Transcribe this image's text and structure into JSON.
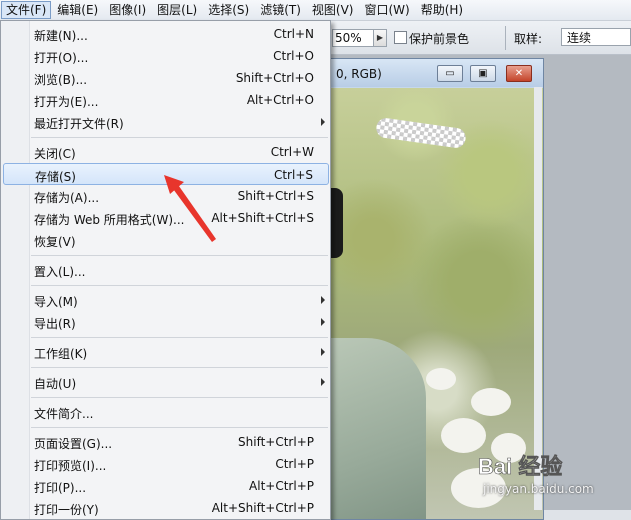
{
  "menubar": {
    "items": [
      {
        "label": "文件(F)"
      },
      {
        "label": "编辑(E)"
      },
      {
        "label": "图像(I)"
      },
      {
        "label": "图层(L)"
      },
      {
        "label": "选择(S)"
      },
      {
        "label": "滤镜(T)"
      },
      {
        "label": "视图(V)"
      },
      {
        "label": "窗口(W)"
      },
      {
        "label": "帮助(H)"
      }
    ]
  },
  "options": {
    "zoom_value": "50%",
    "checkbox_label": "保护前景色",
    "sample_label": "取样:",
    "sample_value": "连续"
  },
  "document": {
    "title_fragment": "0, RGB)",
    "minimize_glyph": "▭",
    "maximize_glyph": "▣",
    "close_glyph": "✕"
  },
  "file_menu": {
    "items": [
      {
        "label": "新建(N)...",
        "shortcut": "Ctrl+N"
      },
      {
        "label": "打开(O)...",
        "shortcut": "Ctrl+O"
      },
      {
        "label": "浏览(B)...",
        "shortcut": "Shift+Ctrl+O"
      },
      {
        "label": "打开为(E)...",
        "shortcut": "Alt+Ctrl+O"
      },
      {
        "label": "最近打开文件(R)",
        "shortcut": ""
      },
      {
        "label": "关闭(C)",
        "shortcut": "Ctrl+W"
      },
      {
        "label": "存储(S)",
        "shortcut": "Ctrl+S"
      },
      {
        "label": "存储为(A)...",
        "shortcut": "Shift+Ctrl+S"
      },
      {
        "label": "存储为 Web 所用格式(W)...",
        "shortcut": "Alt+Shift+Ctrl+S"
      },
      {
        "label": "恢复(V)",
        "shortcut": ""
      },
      {
        "label": "置入(L)...",
        "shortcut": ""
      },
      {
        "label": "导入(M)",
        "shortcut": ""
      },
      {
        "label": "导出(R)",
        "shortcut": ""
      },
      {
        "label": "工作组(K)",
        "shortcut": ""
      },
      {
        "label": "自动(U)",
        "shortcut": ""
      },
      {
        "label": "文件简介...",
        "shortcut": ""
      },
      {
        "label": "页面设置(G)...",
        "shortcut": "Shift+Ctrl+P"
      },
      {
        "label": "打印预览(I)...",
        "shortcut": "Ctrl+P"
      },
      {
        "label": "打印(P)...",
        "shortcut": "Alt+Ctrl+P"
      },
      {
        "label": "打印一份(Y)",
        "shortcut": "Alt+Shift+Ctrl+P"
      }
    ],
    "highlighted": "存储(S)"
  },
  "watermark": {
    "brand": "Bai 经验",
    "url": "jingyan.baidu.com"
  },
  "colors": {
    "highlight": "#d4e5fa",
    "arrow": "#e8352c"
  }
}
